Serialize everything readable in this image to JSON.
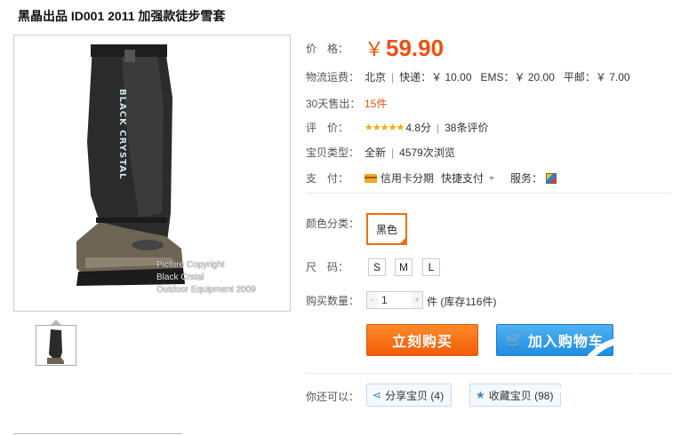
{
  "product": {
    "title": "黑晶出品 ID001 2011 加强款徒步雪套"
  },
  "image": {
    "brand_text": "BLACK CRYSTAL",
    "copyright_lines": [
      "Picture Copyright",
      "Black Crstal",
      "Outdoor Equipment 2009"
    ]
  },
  "price": {
    "label": "价　格：",
    "currency": "￥",
    "value": "59.90"
  },
  "shipping": {
    "label": "物流运费：",
    "origin": "北京",
    "express": "快递：￥ 10.00",
    "ems": "EMS：￥ 20.00",
    "post": "平邮：￥ 7.00"
  },
  "sales": {
    "label": "30天售出：",
    "count": "15件"
  },
  "rating": {
    "label": "评　价：",
    "stars": "★★★★★",
    "score": "4.8分",
    "reviews": "38条评价"
  },
  "item_type": {
    "label": "宝贝类型：",
    "condition": "全新",
    "views": "4579次浏览"
  },
  "payment": {
    "label": "支　付：",
    "credit": "信用卡分期",
    "quick": "快捷支付",
    "service_label": "服务："
  },
  "color": {
    "label": "颜色分类：",
    "selected": "黑色"
  },
  "size": {
    "label": "尺　码：",
    "options": [
      "S",
      "M",
      "L"
    ]
  },
  "quantity": {
    "label": "购买数量：",
    "minus": "-",
    "value": "1",
    "plus": "+",
    "stock": "件 (库存116件)"
  },
  "actions": {
    "buy_now": "立刻购买",
    "add_cart": "加入购物车",
    "cart_glyph": "🛒"
  },
  "social": {
    "label": "你还可以：",
    "share": "分享宝贝 (4)",
    "favorite": "收藏宝贝 (98)"
  },
  "colors": {
    "accent": "#f04f0d",
    "buy": "#f25c06",
    "cart": "#1f8de0"
  }
}
